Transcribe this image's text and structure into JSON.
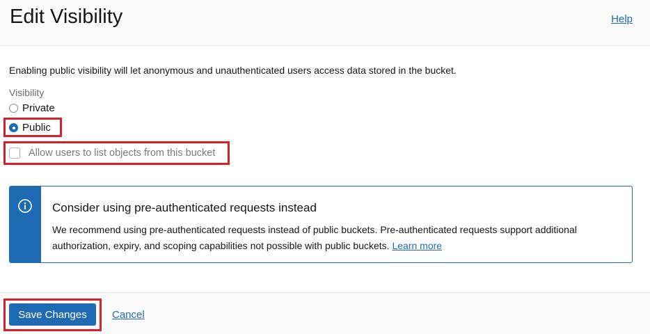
{
  "header": {
    "title": "Edit Visibility",
    "help_label": "Help"
  },
  "body": {
    "description": "Enabling public visibility will let anonymous and unauthenticated users access data stored in the bucket.",
    "visibility_label": "Visibility",
    "options": [
      {
        "label": "Private",
        "selected": false
      },
      {
        "label": "Public",
        "selected": true
      }
    ],
    "allow_list_label": "Allow users to list objects from this bucket",
    "allow_list_checked": false
  },
  "notice": {
    "icon": "info-icon",
    "title": "Consider using pre-authenticated requests instead",
    "text": "We recommend using pre-authenticated requests instead of public buckets. Pre-authenticated requests support additional authorization, expiry, and scoping capabilities not possible with public buckets.",
    "link_label": "Learn more"
  },
  "footer": {
    "save_label": "Save Changes",
    "cancel_label": "Cancel"
  },
  "colors": {
    "accent": "#1f6bb3",
    "highlight": "#d6202b"
  }
}
